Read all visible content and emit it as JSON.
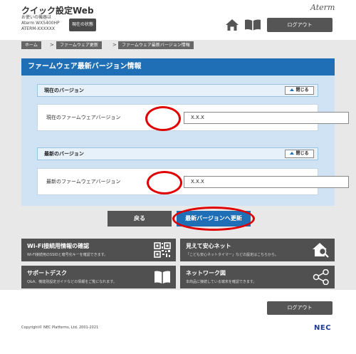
{
  "header": {
    "app_title": "クイック設定Web",
    "device_lines": [
      "お使いの機器は",
      "Aterm WX5400HP",
      "ATERM-XXXXXX"
    ],
    "status_button": "現在の状態",
    "logo": "Aterm",
    "logout_label": "ログアウト",
    "home_icon": "home-icon",
    "manual_icon": "book-icon"
  },
  "breadcrumb": [
    "ホーム",
    "ファームウェア更新",
    "ファームウェア最新バージョン情報"
  ],
  "page_title": "ファームウェア最新バージョン情報",
  "sections": [
    {
      "header": "現在のバージョン",
      "collapse_label": "閉じる",
      "field_label": "現在のファームウェアバージョン",
      "field_value": "X.X.X"
    },
    {
      "header": "最新のバージョン",
      "collapse_label": "閉じる",
      "field_label": "最新のファームウェアバージョン",
      "field_value": "X.X.X"
    }
  ],
  "actions": {
    "back": "戻る",
    "update": "最新バージョンへ更新"
  },
  "tiles": [
    {
      "title": "Wi-Fi接続用情報の確認",
      "desc": "Wi-Fi接続用のSSIDと暗号化キーを確認できます。",
      "icon": "qr-code-icon"
    },
    {
      "title": "見えて安心ネット",
      "desc": "「こども安心ネットタイマー」などの設定はこちらから。",
      "icon": "home-search-icon"
    },
    {
      "title": "サポートデスク",
      "desc": "Q&A、機能別設定ガイドなどの情報をご覧になれます。",
      "icon": "book-icon"
    },
    {
      "title": "ネットワーク図",
      "desc": "本商品に接続している端末を確認できます。",
      "icon": "share-icon"
    }
  ],
  "footer": {
    "logout_label": "ログアウト",
    "copyright": "Copyright© NEC Platforms, Ltd. 2001-2021",
    "brand": "NEC"
  },
  "colors": {
    "accent_blue": "#1e6fb5",
    "dark_button": "#555555",
    "highlight_red": "#e00000",
    "panel_blue": "#cfe3f5"
  }
}
